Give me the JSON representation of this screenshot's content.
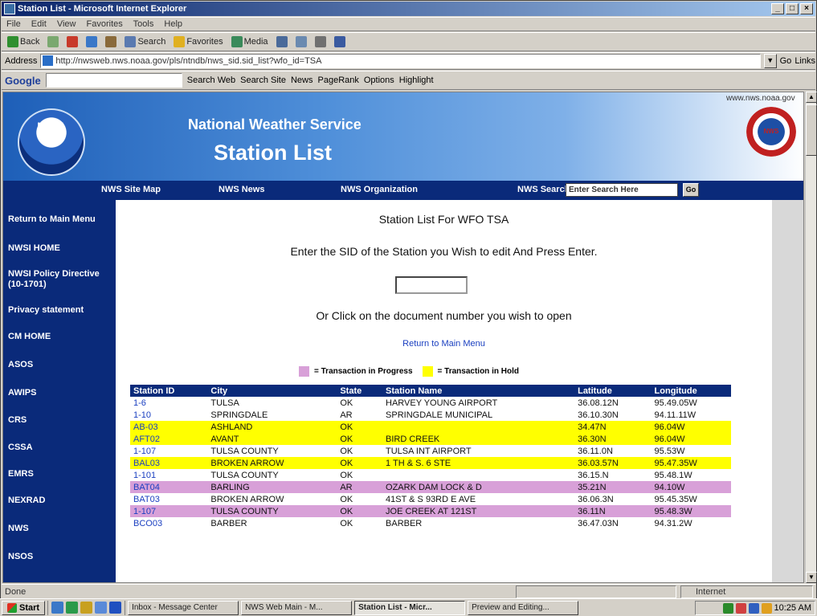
{
  "window": {
    "title": "Station List - Microsoft Internet Explorer"
  },
  "menu": [
    "File",
    "Edit",
    "View",
    "Favorites",
    "Tools",
    "Help"
  ],
  "toolbar": {
    "back": "Back",
    "search": "Search",
    "favorites": "Favorites",
    "media": "Media"
  },
  "address": {
    "label": "Address",
    "url": "http://nwsweb.nws.noaa.gov/pls/ntndb/nws_sid.sid_list?wfo_id=TSA",
    "go": "Go",
    "links": "Links"
  },
  "google": {
    "label": "Google",
    "search_web": "Search Web",
    "search_site": "Search Site",
    "news": "News",
    "blocked": "PageRank",
    "options": "Options",
    "highlight": "Highlight"
  },
  "banner": {
    "agency": "National Weather Service",
    "title": "Station List",
    "top_link": "www.nws.noaa.gov",
    "noaa": "NOAA",
    "nws_seal": "NWS"
  },
  "nav": {
    "site_map": "NWS Site Map",
    "news": "NWS News",
    "organization": "NWS Organization",
    "search_label": "NWS Search",
    "search_placeholder": "Enter Search Here",
    "go": "Go"
  },
  "sidebar": [
    "Return to Main Menu",
    "NWSI HOME",
    "NWSI Policy Directive (10-1701)",
    "Privacy statement",
    "CM HOME",
    "ASOS",
    "AWIPS",
    "CRS",
    "CSSA",
    "EMRS",
    "NEXRAD",
    "NWS",
    "NSOS"
  ],
  "main": {
    "heading": "Station List For WFO TSA",
    "instruction": "Enter the SID of the Station you Wish to edit And Press Enter.",
    "or_text": "Or Click on the document number you wish to open",
    "return_link": "Return to Main Menu",
    "legend_progress": "= Transaction in Progress",
    "legend_hold": "= Transaction in Hold"
  },
  "colors": {
    "progress": "#d8a0d8",
    "hold": "#ffff00"
  },
  "table": {
    "headers": [
      "Station ID",
      "City",
      "State",
      "Station Name",
      "Latitude",
      "Longitude"
    ],
    "rows": [
      {
        "sid": "1-6",
        "city": "TULSA",
        "state": "OK",
        "name": "HARVEY YOUNG AIRPORT",
        "lat": "36.08.12N",
        "lon": "95.49.05W",
        "status": ""
      },
      {
        "sid": "1-10",
        "city": "SPRINGDALE",
        "state": "AR",
        "name": "SPRINGDALE MUNICIPAL",
        "lat": "36.10.30N",
        "lon": "94.11.11W",
        "status": ""
      },
      {
        "sid": "AB-03",
        "city": "ASHLAND",
        "state": "OK",
        "name": "",
        "lat": "34.47N",
        "lon": "96.04W",
        "status": "hold"
      },
      {
        "sid": "AFT02",
        "city": "AVANT",
        "state": "OK",
        "name": "BIRD CREEK",
        "lat": "36.30N",
        "lon": "96.04W",
        "status": "hold"
      },
      {
        "sid": "1-107",
        "city": "TULSA COUNTY",
        "state": "OK",
        "name": "TULSA INT AIRPORT",
        "lat": "36.11.0N",
        "lon": "95.53W",
        "status": ""
      },
      {
        "sid": "BAL03",
        "city": "BROKEN ARROW",
        "state": "OK",
        "name": "1 TH & S. 6 STE",
        "lat": "36.03.57N",
        "lon": "95.47.35W",
        "status": "hold"
      },
      {
        "sid": "1-101",
        "city": "TULSA COUNTY",
        "state": "OK",
        "name": "",
        "lat": "36.15.N",
        "lon": "95.48.1W",
        "status": ""
      },
      {
        "sid": "BAT04",
        "city": "BARLING",
        "state": "AR",
        "name": "OZARK DAM LOCK & D",
        "lat": "35.21N",
        "lon": "94.10W",
        "status": "progress"
      },
      {
        "sid": "BAT03",
        "city": "BROKEN ARROW",
        "state": "OK",
        "name": "41ST & S 93RD E AVE",
        "lat": "36.06.3N",
        "lon": "95.45.35W",
        "status": ""
      },
      {
        "sid": "1-107",
        "city": "TULSA COUNTY",
        "state": "OK",
        "name": "JOE CREEK AT 121ST",
        "lat": "36.11N",
        "lon": "95.48.3W",
        "status": "progress"
      },
      {
        "sid": "BCO03",
        "city": "BARBER",
        "state": "OK",
        "name": "BARBER",
        "lat": "36.47.03N",
        "lon": "94.31.2W",
        "status": ""
      }
    ]
  },
  "status": {
    "text": "Done",
    "zone": "Internet"
  },
  "taskbar": {
    "start": "Start",
    "tasks": [
      "Inbox - Message Center",
      "NWS Web Main - M...",
      "Station List - Micr...",
      "Preview and Editing..."
    ],
    "clock": "10:25 AM"
  }
}
